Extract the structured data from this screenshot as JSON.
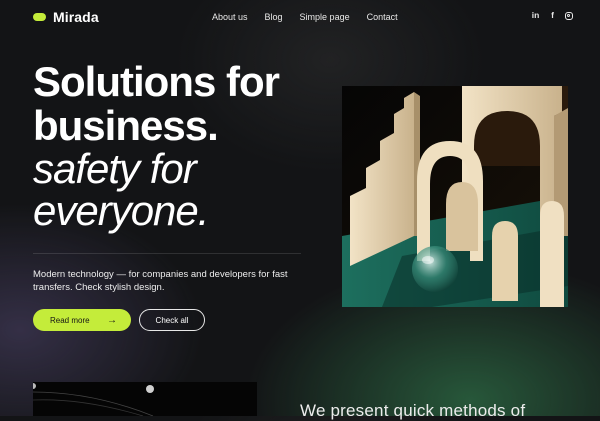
{
  "brand": {
    "name": "Mirada",
    "accent": "#c4ec3a"
  },
  "nav": {
    "items": [
      "About us",
      "Blog",
      "Simple page",
      "Contact"
    ]
  },
  "social": {
    "icons": [
      "linkedin-icon",
      "facebook-icon",
      "instagram-icon"
    ],
    "linkedin": "in",
    "facebook": "f"
  },
  "hero": {
    "line1": "Solutions for",
    "line2": "business.",
    "line3": "safety for",
    "line4": "everyone.",
    "description": "Modern technology — for companies and developers for fast transfers. Check stylish design.",
    "primary_button": "Read more",
    "primary_arrow": "→",
    "secondary_button": "Check all"
  },
  "section": {
    "title": "We present quick methods of"
  },
  "colors": {
    "background": "#131416",
    "accent": "#c4ec3a",
    "teal": "#1f7a64",
    "sand": "#e9d9bd"
  }
}
